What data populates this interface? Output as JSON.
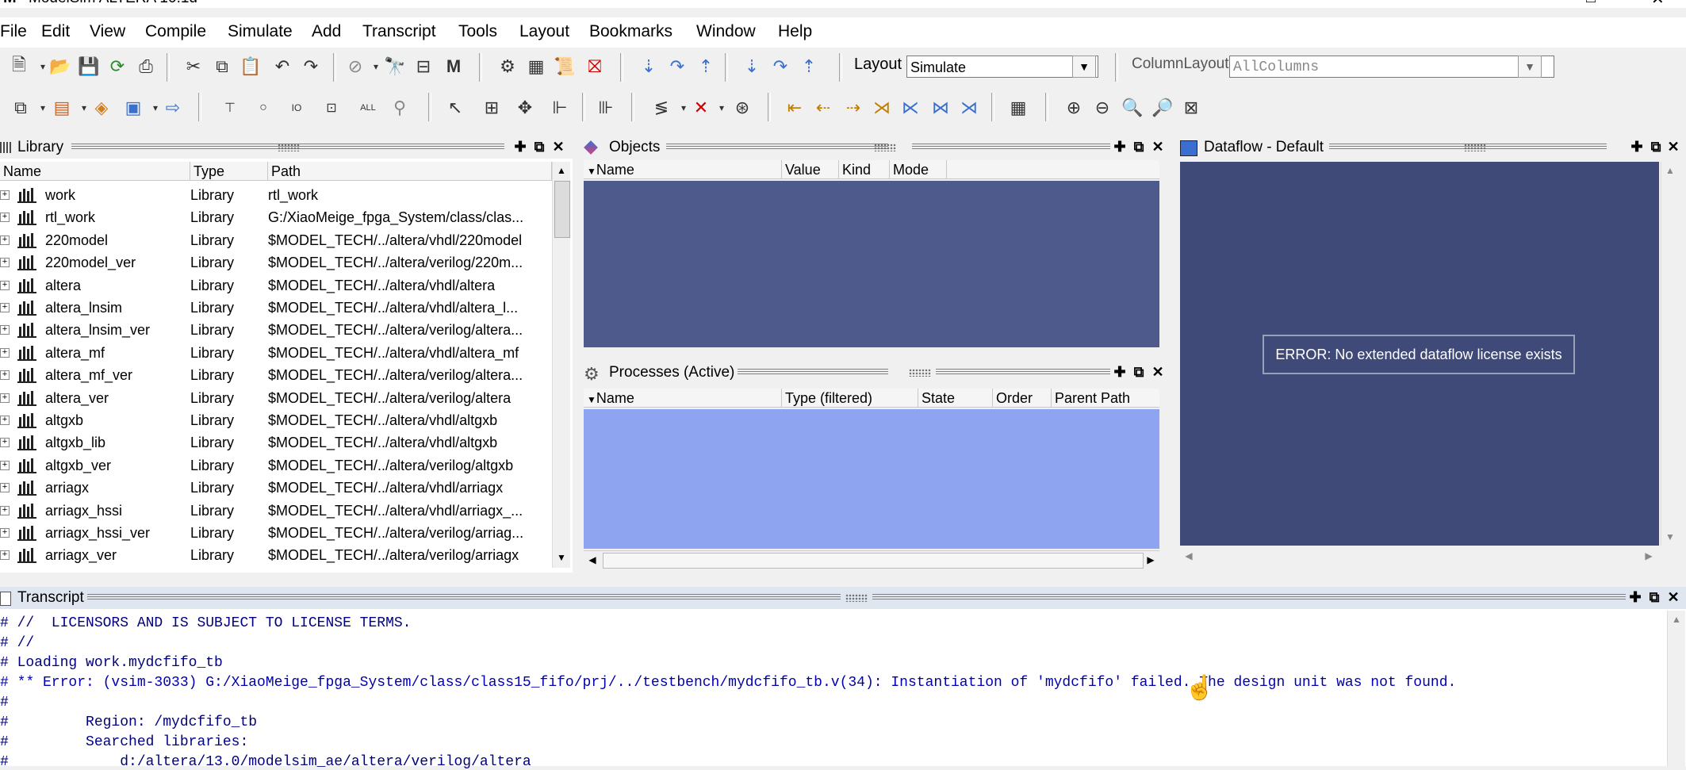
{
  "window": {
    "title": "ModelSim ALTERA 10.1d"
  },
  "menu": [
    "File",
    "Edit",
    "View",
    "Compile",
    "Simulate",
    "Add",
    "Transcript",
    "Tools",
    "Layout",
    "Bookmarks",
    "Window",
    "Help"
  ],
  "toolbar": {
    "layout_label": "Layout",
    "layout_value": "Simulate",
    "column_layout_label": "ColumnLayout",
    "column_layout_value": "AllColumns"
  },
  "library": {
    "title": "Library",
    "columns": [
      "Name",
      "Type",
      "Path"
    ],
    "rows": [
      {
        "name": "work",
        "type": "Library",
        "path": "rtl_work"
      },
      {
        "name": "rtl_work",
        "type": "Library",
        "path": "G:/XiaoMeige_fpga_System/class/clas..."
      },
      {
        "name": "220model",
        "type": "Library",
        "path": "$MODEL_TECH/../altera/vhdl/220model"
      },
      {
        "name": "220model_ver",
        "type": "Library",
        "path": "$MODEL_TECH/../altera/verilog/220m..."
      },
      {
        "name": "altera",
        "type": "Library",
        "path": "$MODEL_TECH/../altera/vhdl/altera"
      },
      {
        "name": "altera_lnsim",
        "type": "Library",
        "path": "$MODEL_TECH/../altera/vhdl/altera_l..."
      },
      {
        "name": "altera_lnsim_ver",
        "type": "Library",
        "path": "$MODEL_TECH/../altera/verilog/altera..."
      },
      {
        "name": "altera_mf",
        "type": "Library",
        "path": "$MODEL_TECH/../altera/vhdl/altera_mf"
      },
      {
        "name": "altera_mf_ver",
        "type": "Library",
        "path": "$MODEL_TECH/../altera/verilog/altera..."
      },
      {
        "name": "altera_ver",
        "type": "Library",
        "path": "$MODEL_TECH/../altera/verilog/altera"
      },
      {
        "name": "altgxb",
        "type": "Library",
        "path": "$MODEL_TECH/../altera/vhdl/altgxb"
      },
      {
        "name": "altgxb_lib",
        "type": "Library",
        "path": "$MODEL_TECH/../altera/vhdl/altgxb"
      },
      {
        "name": "altgxb_ver",
        "type": "Library",
        "path": "$MODEL_TECH/../altera/verilog/altgxb"
      },
      {
        "name": "arriagx",
        "type": "Library",
        "path": "$MODEL_TECH/../altera/vhdl/arriagx"
      },
      {
        "name": "arriagx_hssi",
        "type": "Library",
        "path": "$MODEL_TECH/../altera/vhdl/arriagx_..."
      },
      {
        "name": "arriagx_hssi_ver",
        "type": "Library",
        "path": "$MODEL_TECH/../altera/verilog/arriag..."
      },
      {
        "name": "arriagx_ver",
        "type": "Library",
        "path": "$MODEL_TECH/../altera/verilog/arriagx"
      }
    ]
  },
  "objects": {
    "title": "Objects",
    "columns": [
      "Name",
      "Value",
      "Kind",
      "Mode"
    ]
  },
  "processes": {
    "title": "Processes (Active)",
    "columns": [
      "Name",
      "Type (filtered)",
      "State",
      "Order",
      "Parent Path"
    ]
  },
  "dataflow": {
    "title": "Dataflow - Default",
    "error": "ERROR: No extended dataflow license exists"
  },
  "transcript": {
    "title": "Transcript",
    "lines": [
      "# //  LICENSORS AND IS SUBJECT TO LICENSE TERMS.",
      "# //",
      "# Loading work.mydcfifo_tb",
      "# ** Error: (vsim-3033) G:/XiaoMeige_fpga_System/class/class15_fifo/prj/../testbench/mydcfifo_tb.v(34): Instantiation of 'mydcfifo' failed. The design unit was not found.",
      "#",
      "#         Region: /mydcfifo_tb",
      "#         Searched libraries:",
      "#             d:/altera/13.0/modelsim_ae/altera/verilog/altera"
    ]
  },
  "colors": {
    "objects_bg": "#4e5a8c",
    "processes_bg": "#8ea4f0",
    "dataflow_bg": "#404a78",
    "transcript_text": "#000080"
  }
}
